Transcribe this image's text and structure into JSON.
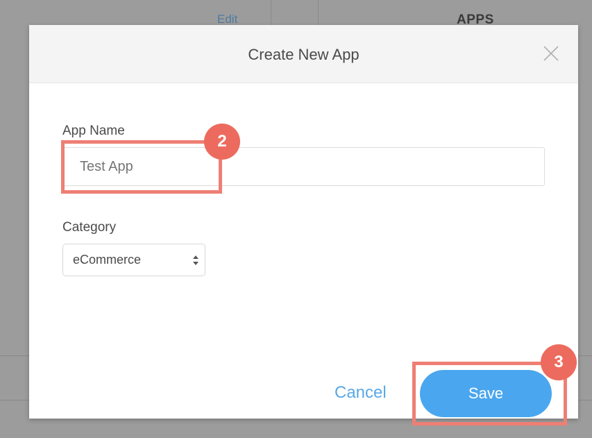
{
  "background": {
    "edit_link": "Edit",
    "apps_header": "APPS"
  },
  "modal": {
    "title": "Create New App",
    "close_icon": "close-icon",
    "app_name": {
      "label": "App Name",
      "placeholder": "Test App"
    },
    "category": {
      "label": "Category",
      "selected": "eCommerce"
    },
    "cancel_label": "Cancel",
    "save_label": "Save"
  },
  "annotations": {
    "step_2": "2",
    "step_3": "3",
    "color": "#ee7f74"
  },
  "colors": {
    "accent": "#4aa6ee",
    "link": "#5aa8e6"
  }
}
